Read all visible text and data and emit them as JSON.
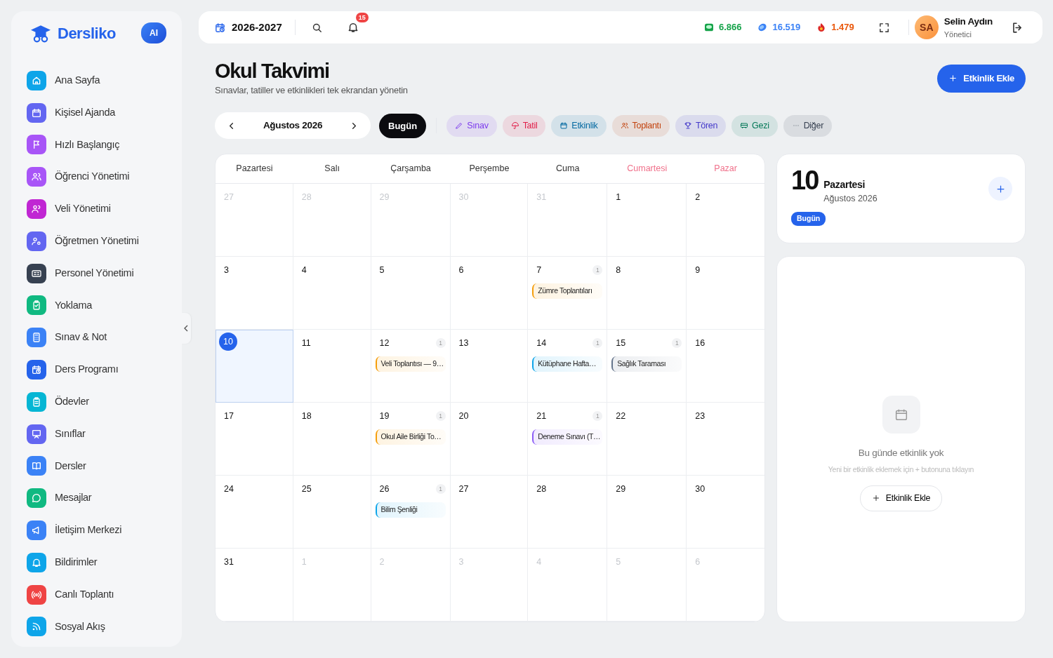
{
  "brand": {
    "name": "Dersliko",
    "ai_label": "AI"
  },
  "sidebar": {
    "items": [
      {
        "label": "Ana Sayfa",
        "color": "#0ea5e9"
      },
      {
        "label": "Kişisel Ajanda",
        "color": "#6366f1"
      },
      {
        "label": "Hızlı Başlangıç",
        "color": "#a855f7"
      },
      {
        "label": "Öğrenci Yönetimi",
        "color": "#a855f7"
      },
      {
        "label": "Veli Yönetimi",
        "color": "#c026d3"
      },
      {
        "label": "Öğretmen Yönetimi",
        "color": "#6366f1"
      },
      {
        "label": "Personel Yönetimi",
        "color": "#374151"
      },
      {
        "label": "Yoklama",
        "color": "#10b981"
      },
      {
        "label": "Sınav & Not",
        "color": "#3b82f6"
      },
      {
        "label": "Ders Programı",
        "color": "#2563eb"
      },
      {
        "label": "Ödevler",
        "color": "#06b6d4"
      },
      {
        "label": "Sınıflar",
        "color": "#6366f1"
      },
      {
        "label": "Dersler",
        "color": "#3b82f6"
      },
      {
        "label": "Mesajlar",
        "color": "#10b981"
      },
      {
        "label": "İletişim Merkezi",
        "color": "#3b82f6"
      },
      {
        "label": "Bildirimler",
        "color": "#0ea5e9"
      },
      {
        "label": "Canlı Toplantı",
        "color": "#ef4444"
      },
      {
        "label": "Sosyal Akış",
        "color": "#0ea5e9"
      }
    ]
  },
  "topbar": {
    "year": "2026-2027",
    "notifications": "15",
    "stats": [
      {
        "value": "6.866",
        "color": "#16a34a"
      },
      {
        "value": "16.519",
        "color": "#3b82f6"
      },
      {
        "value": "1.479",
        "color": "#ea580c"
      }
    ],
    "user": {
      "initials": "SA",
      "name": "Selin Aydın",
      "role": "Yönetici"
    }
  },
  "page": {
    "title": "Okul Takvimi",
    "subtitle": "Sınavlar, tatiller ve etkinlikleri tek ekrandan yönetin",
    "add_button": "Etkinlik Ekle"
  },
  "month_nav": {
    "label": "Ağustos 2026",
    "today_button": "Bugün"
  },
  "filters": [
    {
      "label": "Sınav",
      "color": "#7c3aed"
    },
    {
      "label": "Tatil",
      "color": "#e11d48"
    },
    {
      "label": "Etkinlik",
      "color": "#0369a1"
    },
    {
      "label": "Toplantı",
      "color": "#c2410c"
    },
    {
      "label": "Tören",
      "color": "#4338ca"
    },
    {
      "label": "Gezi",
      "color": "#047857"
    },
    {
      "label": "Diğer",
      "color": "#374151"
    }
  ],
  "calendar": {
    "weekdays": [
      {
        "label": "Pazartesi",
        "weekend": false
      },
      {
        "label": "Salı",
        "weekend": false
      },
      {
        "label": "Çarşamba",
        "weekend": false
      },
      {
        "label": "Perşembe",
        "weekend": false
      },
      {
        "label": "Cuma",
        "weekend": false
      },
      {
        "label": "Cumartesi",
        "weekend": true
      },
      {
        "label": "Pazar",
        "weekend": true
      }
    ],
    "weeks": [
      [
        {
          "day": "27",
          "muted": true,
          "selected": false
        },
        {
          "day": "28",
          "muted": true,
          "selected": false
        },
        {
          "day": "29",
          "muted": true,
          "selected": false
        },
        {
          "day": "30",
          "muted": true,
          "selected": false
        },
        {
          "day": "31",
          "muted": true,
          "selected": false
        },
        {
          "day": "1",
          "muted": false,
          "selected": false
        },
        {
          "day": "2",
          "muted": false,
          "selected": false
        }
      ],
      [
        {
          "day": "3",
          "muted": false,
          "selected": false
        },
        {
          "day": "4",
          "muted": false,
          "selected": false
        },
        {
          "day": "5",
          "muted": false,
          "selected": false
        },
        {
          "day": "6",
          "muted": false,
          "selected": false
        },
        {
          "day": "7",
          "muted": false,
          "selected": false,
          "count": "1",
          "event": {
            "title": "Zümre Toplantıları",
            "color": "#f59e0b"
          }
        },
        {
          "day": "8",
          "muted": false,
          "selected": false
        },
        {
          "day": "9",
          "muted": false,
          "selected": false
        }
      ],
      [
        {
          "day": "10",
          "muted": false,
          "selected": true
        },
        {
          "day": "11",
          "muted": false,
          "selected": false
        },
        {
          "day": "12",
          "muted": false,
          "selected": false,
          "count": "1",
          "event": {
            "title": "Veli Toplantısı — 9…",
            "color": "#f59e0b"
          }
        },
        {
          "day": "13",
          "muted": false,
          "selected": false
        },
        {
          "day": "14",
          "muted": false,
          "selected": false,
          "count": "1",
          "event": {
            "title": "Kütüphane Hafta…",
            "color": "#0ea5e9"
          }
        },
        {
          "day": "15",
          "muted": false,
          "selected": false,
          "count": "1",
          "event": {
            "title": "Sağlık Taraması",
            "color": "#64748b"
          }
        },
        {
          "day": "16",
          "muted": false,
          "selected": false
        }
      ],
      [
        {
          "day": "17",
          "muted": false,
          "selected": false
        },
        {
          "day": "18",
          "muted": false,
          "selected": false
        },
        {
          "day": "19",
          "muted": false,
          "selected": false,
          "count": "1",
          "event": {
            "title": "Okul Aile Birliği To…",
            "color": "#f59e0b"
          }
        },
        {
          "day": "20",
          "muted": false,
          "selected": false
        },
        {
          "day": "21",
          "muted": false,
          "selected": false,
          "count": "1",
          "event": {
            "title": "Deneme Sınavı (T…",
            "color": "#8b5cf6"
          }
        },
        {
          "day": "22",
          "muted": false,
          "selected": false
        },
        {
          "day": "23",
          "muted": false,
          "selected": false
        }
      ],
      [
        {
          "day": "24",
          "muted": false,
          "selected": false
        },
        {
          "day": "25",
          "muted": false,
          "selected": false
        },
        {
          "day": "26",
          "muted": false,
          "selected": false,
          "count": "1",
          "event": {
            "title": "Bilim Şenliği",
            "color": "#0ea5e9"
          }
        },
        {
          "day": "27",
          "muted": false,
          "selected": false
        },
        {
          "day": "28",
          "muted": false,
          "selected": false
        },
        {
          "day": "29",
          "muted": false,
          "selected": false
        },
        {
          "day": "30",
          "muted": false,
          "selected": false
        }
      ],
      [
        {
          "day": "31",
          "muted": false,
          "selected": false
        },
        {
          "day": "1",
          "muted": true,
          "selected": false
        },
        {
          "day": "2",
          "muted": true,
          "selected": false
        },
        {
          "day": "3",
          "muted": true,
          "selected": false
        },
        {
          "day": "4",
          "muted": true,
          "selected": false
        },
        {
          "day": "5",
          "muted": true,
          "selected": false
        },
        {
          "day": "6",
          "muted": true,
          "selected": false
        }
      ]
    ]
  },
  "day_panel": {
    "day": "10",
    "weekday": "Pazartesi",
    "month": "Ağustos 2026",
    "badge": "Bugün",
    "empty_title": "Bu günde etkinlik yok",
    "empty_hint": "Yeni bir etkinlik eklemek için + butonuna tıklayın",
    "add_button": "Etkinlik Ekle"
  }
}
